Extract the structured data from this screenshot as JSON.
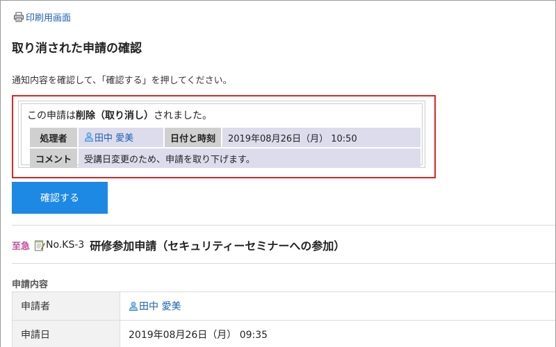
{
  "header": {
    "print_label": "印刷用画面"
  },
  "page": {
    "title": "取り消された申請の確認",
    "instruction": "通知内容を確認して、「確認する」を押してください。"
  },
  "notice": {
    "message_prefix": "この申請は",
    "message_bold": "削除（取り消し）",
    "message_suffix": "されました。",
    "handler_label": "処理者",
    "handler_name": "田中 愛美",
    "datetime_label": "日付と時刻",
    "datetime_value": "2019年08月26日（月） 10:50",
    "comment_label": "コメント",
    "comment_value": "受講日変更のため、申請を取り下げます。"
  },
  "actions": {
    "confirm_label": "確認する"
  },
  "request": {
    "priority": "至急",
    "number": "No.KS-3",
    "title": "研修参加申請（セキュリティーセミナーへの参加）",
    "section_label": "申請内容",
    "rows": [
      {
        "label": "申請者",
        "value": "田中 愛美",
        "is_user": true
      },
      {
        "label": "申請日",
        "value": "2019年08月26日（月） 09:35",
        "is_user": false
      }
    ]
  },
  "colors": {
    "accent_button": "#1e88e5",
    "highlight_border": "#e02020",
    "link": "#1a5fb4",
    "urgent": "#c0509a"
  }
}
